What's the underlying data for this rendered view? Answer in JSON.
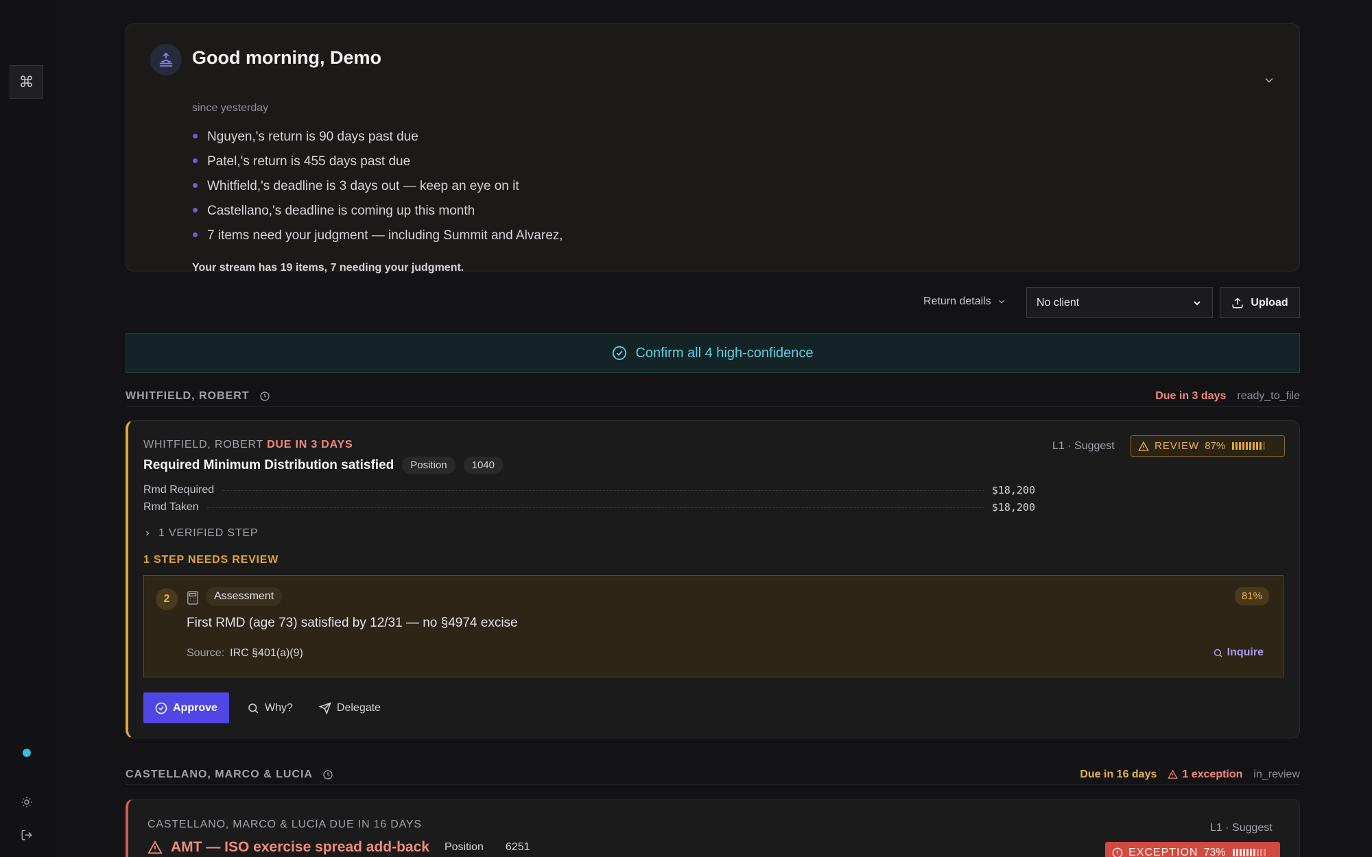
{
  "sidebar": {
    "command_icon": "⌘",
    "status_dot_color": "#38bdd8"
  },
  "greeting": {
    "title": "Good morning, Demo",
    "since": "since yesterday",
    "items": [
      "Nguyen,'s return is 90 days past due",
      "Patel,'s return is 455 days past due",
      "Whitfield,'s deadline is 3 days out — keep an eye on it",
      "Castellano,'s deadline is coming up this month",
      "7 items need your judgment — including Summit and Alvarez,"
    ],
    "footer": "Your stream has 19 items, 7 needing your judgment."
  },
  "toolbar": {
    "return_details_label": "Return details",
    "client_select_value": "No client",
    "upload_label": "Upload"
  },
  "confirm": {
    "label": "Confirm all 4 high-confidence"
  },
  "groups": [
    {
      "name": "WHITFIELD, ROBERT",
      "due": "Due in 3 days",
      "status": "ready_to_file",
      "card": {
        "client": "WHITFIELD, ROBERT",
        "due": "DUE IN 3 DAYS",
        "title": "Required Minimum Distribution satisfied",
        "chips": [
          "Position",
          "1040"
        ],
        "level": "L1 · Suggest",
        "badge_label": "REVIEW",
        "badge_pct": "87%",
        "badge_confidence": 0.87,
        "rows": [
          {
            "label": "Rmd Required",
            "value": "$18,200"
          },
          {
            "label": "Rmd Taken",
            "value": "$18,200"
          }
        ],
        "verified": "1 VERIFIED STEP",
        "needs_review": "1 STEP NEEDS REVIEW",
        "step": {
          "number": "2",
          "kind": "Assessment",
          "pct": "81%",
          "text": "First RMD (age 73) satisfied by 12/31 — no §4974 excise",
          "source_label": "Source:",
          "source": "IRC §401(a)(9)",
          "inquire": "Inquire"
        },
        "actions": {
          "approve": "Approve",
          "why": "Why?",
          "delegate": "Delegate"
        }
      }
    },
    {
      "name": "CASTELLANO, MARCO & LUCIA",
      "due": "Due in 16 days",
      "exception": "1 exception",
      "status": "in_review",
      "card": {
        "client": "CASTELLANO, MARCO & LUCIA",
        "due": "DUE IN 16 DAYS",
        "title": "AMT — ISO exercise spread add-back",
        "chips": [
          "Position",
          "6251"
        ],
        "level": "L1 · Suggest",
        "badge_label": "EXCEPTION",
        "badge_pct": "73%",
        "badge_confidence": 0.73
      }
    }
  ],
  "colors": {
    "accent": "#4f46e5",
    "warning": "#e2a634",
    "danger": "#d6584e",
    "teal": "#5ed0de"
  }
}
